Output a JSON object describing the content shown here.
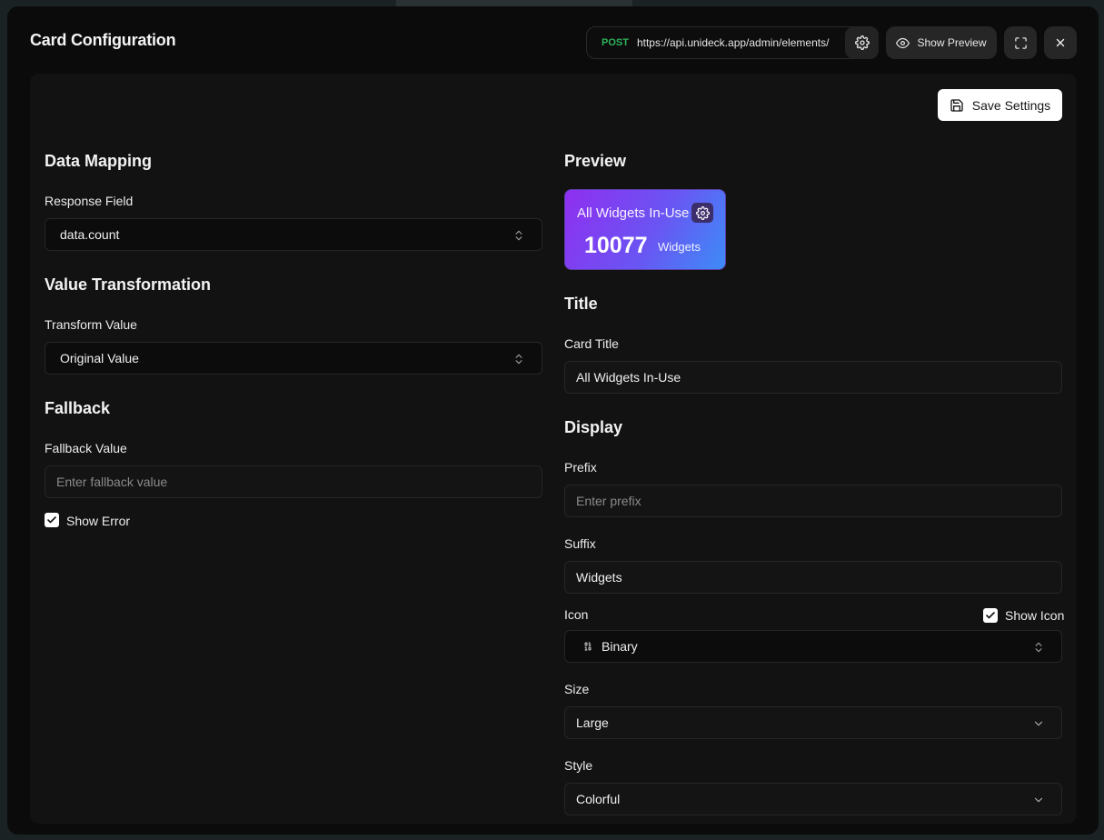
{
  "modal": {
    "title": "Card Configuration",
    "endpoint": {
      "method": "POST",
      "url": "https://api.unideck.app/admin/elements/"
    },
    "show_preview_label": "Show Preview"
  },
  "toolbar": {
    "save_label": "Save Settings"
  },
  "left": {
    "data_mapping": {
      "title": "Data Mapping",
      "response_field_label": "Response Field",
      "response_field_value": "data.count"
    },
    "value_transformation": {
      "title": "Value Transformation",
      "transform_label": "Transform Value",
      "transform_value": "Original Value"
    },
    "fallback": {
      "title": "Fallback",
      "fallback_label": "Fallback Value",
      "fallback_placeholder": "Enter fallback value",
      "show_error_label": "Show Error",
      "show_error_checked": true
    }
  },
  "right": {
    "preview": {
      "title": "Preview",
      "card_title": "All Widgets In-Use",
      "card_value": "10077",
      "card_suffix": "Widgets",
      "gradient_start": "#8f2ff0",
      "gradient_end": "#3d8cf7"
    },
    "title_section": {
      "title": "Title",
      "card_title_label": "Card Title",
      "card_title_value": "All Widgets In-Use"
    },
    "display": {
      "title": "Display",
      "prefix_label": "Prefix",
      "prefix_placeholder": "Enter prefix",
      "suffix_label": "Suffix",
      "suffix_value": "Widgets",
      "icon_label": "Icon",
      "show_icon_label": "Show Icon",
      "show_icon_checked": true,
      "icon_value": "Binary",
      "icon_name": "binary-icon",
      "size_label": "Size",
      "size_value": "Large",
      "style_label": "Style",
      "style_value": "Colorful"
    }
  },
  "colors": {
    "method_post": "#2fb45c",
    "background": "#0b0b0b",
    "panel": "#121212"
  }
}
